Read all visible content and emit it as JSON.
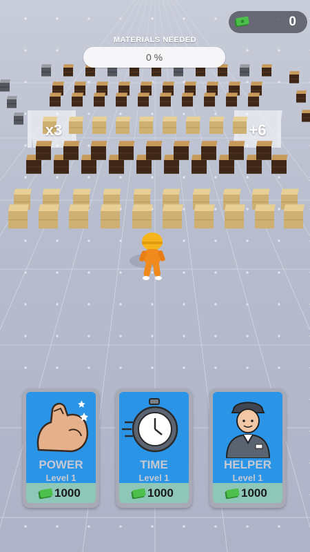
{
  "hud": {
    "money": "0",
    "materials_title": "MATERIALS NEEDED",
    "materials_percent": "0 %",
    "materials_progress": 0
  },
  "gates": {
    "left": "x3",
    "right": "+6"
  },
  "upgrades": [
    {
      "name": "POWER",
      "level": "Level 1",
      "price": "1000",
      "icon": "flexed-arm-icon"
    },
    {
      "name": "TIME",
      "level": "Level 1",
      "price": "1000",
      "icon": "stopwatch-icon"
    },
    {
      "name": "HELPER",
      "level": "Level 1",
      "price": "1000",
      "icon": "worker-icon"
    }
  ],
  "colors": {
    "card_blue": "#2a94e6",
    "price_bar": "#8ec7b7",
    "cash_green": "#3aa83a",
    "worker_orange": "#f08a1c",
    "helmet_yellow": "#f6b51c"
  }
}
